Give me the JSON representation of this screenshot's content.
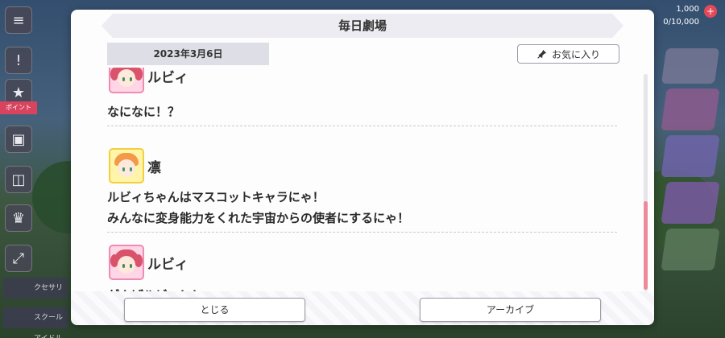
{
  "dialog": {
    "title": "毎日劇場",
    "date": "2023年3月6日",
    "favorite_label": "お気に入り",
    "entries": [
      {
        "speaker": "ルビィ",
        "avatar": "ruby-avatar",
        "lines": [
          "なになに！？"
        ]
      },
      {
        "speaker": "凛",
        "avatar": "rin-avatar",
        "lines": [
          "ルビィちゃんはマスコットキャラにゃ！",
          "みんなに変身能力をくれた宇宙からの使者にするにゃ！"
        ]
      },
      {
        "speaker": "ルビィ",
        "avatar": "ruby-avatar",
        "lines": [
          "がんばルビィ！！"
        ]
      }
    ],
    "close_label": "とじる",
    "archive_label": "アーカイブ"
  },
  "background": {
    "left_rail": {
      "badge": "ポイント",
      "label1": "クセサリ",
      "label2": "スクール\nアイドル"
    },
    "right_rail": {
      "top_value": "1,000",
      "sub_value": "0/10,000"
    }
  },
  "colors": {
    "accent_pink": "#ee8a99",
    "title_bar": "#ececf2",
    "date_chip": "#dedee6"
  }
}
